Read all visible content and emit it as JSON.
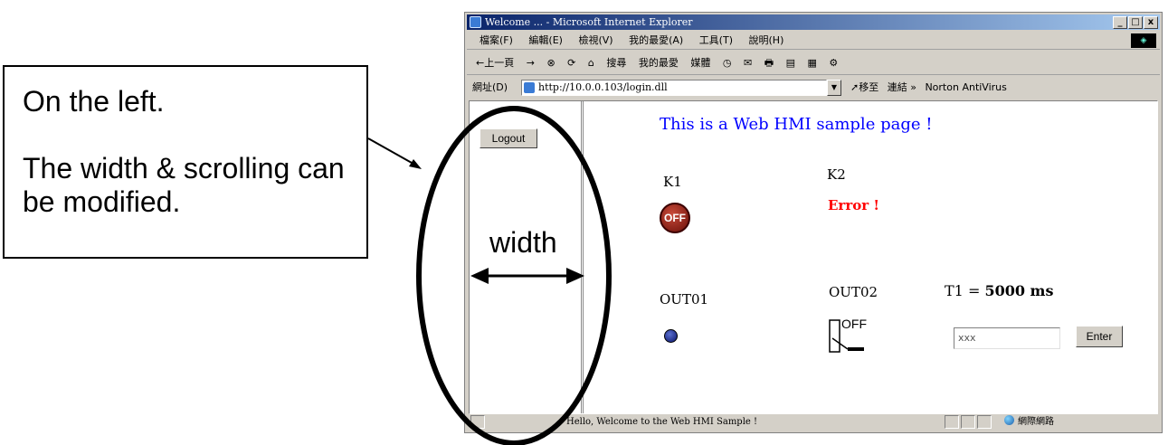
{
  "callout": {
    "line1": "On the left.",
    "line2": "The width & scrolling can be modified."
  },
  "annotation": {
    "width_label": "width"
  },
  "browser": {
    "title": "Welcome ... - Microsoft Internet Explorer",
    "window_buttons": [
      "_",
      "□",
      "x"
    ],
    "menu": [
      "檔案(F)",
      "編輯(E)",
      "檢視(V)",
      "我的最愛(A)",
      "工具(T)",
      "說明(H)"
    ],
    "toolbar": [
      "←上一頁",
      "→",
      "⊗",
      "⟳",
      "⌂",
      "搜尋",
      "我的最愛",
      "媒體",
      "◷",
      "✉",
      "🖶",
      "▤",
      "▦",
      "⚙"
    ],
    "address_label": "網址(D)",
    "address_url": "http://10.0.0.103/login.dll",
    "go_label": "➚移至",
    "links_label": "連結 »",
    "norton_label": "Norton AntiVirus"
  },
  "left_frame": {
    "logout_label": "Logout"
  },
  "main": {
    "heading": "This is a Web HMI sample page !",
    "k1_label": "K1",
    "k1_lamp": "OFF",
    "k2_label": "K2",
    "k2_status": "Error !",
    "out01_label": "OUT01",
    "out02_label": "OUT02",
    "out02_switch": "OFF",
    "t1_label": "T1 = ",
    "t1_value": "5000 ms",
    "t1_input_value": "xxx",
    "enter_label": "Enter"
  },
  "status": {
    "text": "Hello, Welcome to the Web HMI Sample !",
    "zone": "網際網路"
  },
  "colors": {
    "heading": "#0000ff",
    "error": "#ff0000",
    "titlebar_start": "#0a246a"
  }
}
